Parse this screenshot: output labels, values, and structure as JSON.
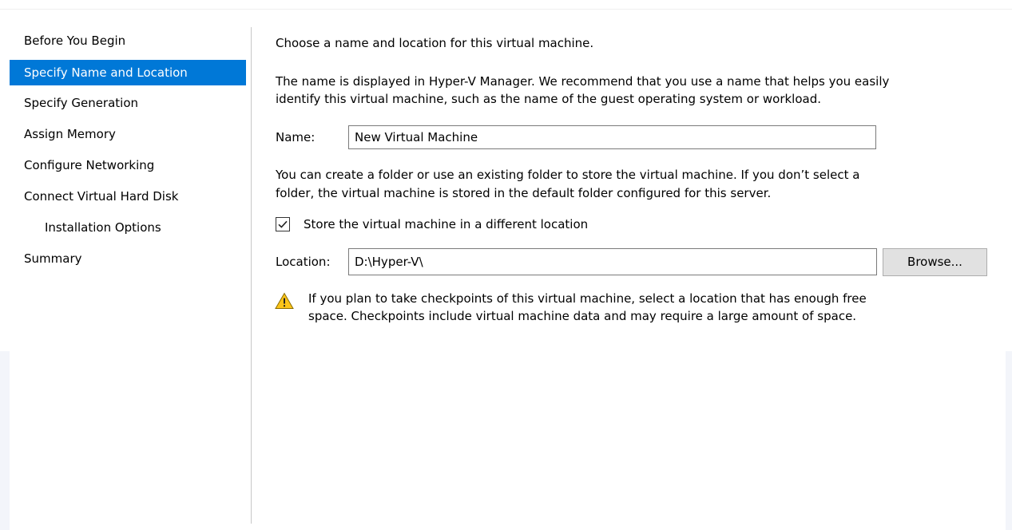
{
  "nav": {
    "items": [
      {
        "label": "Before You Begin",
        "active": false,
        "indent": false
      },
      {
        "label": "Specify Name and Location",
        "active": true,
        "indent": false
      },
      {
        "label": "Specify Generation",
        "active": false,
        "indent": false
      },
      {
        "label": "Assign Memory",
        "active": false,
        "indent": false
      },
      {
        "label": "Configure Networking",
        "active": false,
        "indent": false
      },
      {
        "label": "Connect Virtual Hard Disk",
        "active": false,
        "indent": false
      },
      {
        "label": "Installation Options",
        "active": false,
        "indent": true
      },
      {
        "label": "Summary",
        "active": false,
        "indent": false
      }
    ]
  },
  "main": {
    "heading": "Choose a name and location for this virtual machine.",
    "name_description_line1": "The name is displayed in Hyper-V Manager. We recommend that you use a name that helps you easily",
    "name_description_line2": "identify this virtual machine, such as the name of the guest operating system or workload.",
    "name_label": "Name:",
    "name_value": "New Virtual Machine",
    "folder_description_line1": "You can create a folder or use an existing folder to store the virtual machine. If you don’t select a",
    "folder_description_line2": "folder, the virtual machine is stored in the default folder configured for this server.",
    "store_checkbox_label": "Store the virtual machine in a different location",
    "store_checkbox_checked": true,
    "location_label": "Location:",
    "location_value": "D:\\Hyper-V\\",
    "browse_label": "Browse...",
    "warning_line1": "If you plan to take checkpoints of this virtual machine, select a location that has enough free",
    "warning_line2": "space. Checkpoints include virtual machine data and may require a large amount of space.",
    "warning_icon": "warning-triangle-icon"
  },
  "colors": {
    "selection": "#0078d7",
    "warning_fill": "#fcc419",
    "divider": "#c8c8c8"
  }
}
